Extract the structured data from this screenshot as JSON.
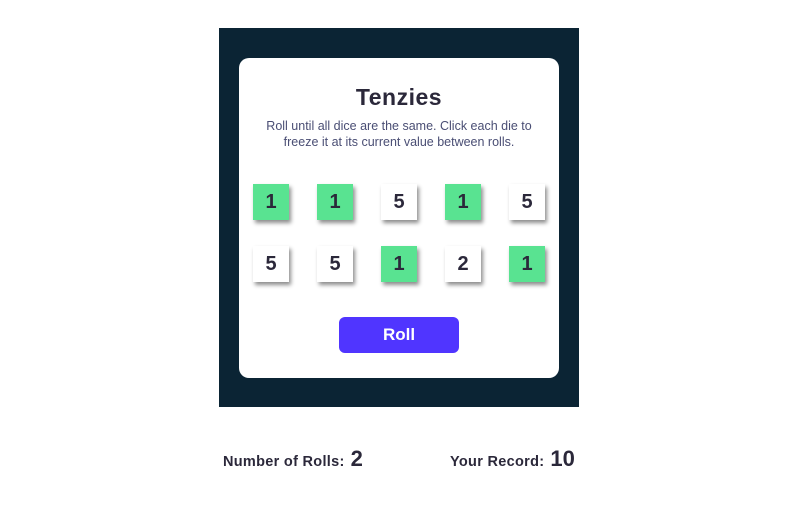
{
  "game": {
    "title": "Tenzies",
    "instructions": "Roll until all dice are the same. Click each die to freeze it at its current value between rolls.",
    "roll_label": "Roll",
    "dice": [
      {
        "value": "1",
        "held": true
      },
      {
        "value": "1",
        "held": true
      },
      {
        "value": "5",
        "held": false
      },
      {
        "value": "1",
        "held": true
      },
      {
        "value": "5",
        "held": false
      },
      {
        "value": "5",
        "held": false
      },
      {
        "value": "5",
        "held": false
      },
      {
        "value": "1",
        "held": true
      },
      {
        "value": "2",
        "held": false
      },
      {
        "value": "1",
        "held": true
      }
    ]
  },
  "stats": {
    "rolls_label": "Number of Rolls:",
    "rolls_value": "2",
    "record_label": "Your Record:",
    "record_value": "10"
  },
  "colors": {
    "frame": "#0b2434",
    "held_die": "#59e391",
    "roll_button": "#5035ff"
  }
}
